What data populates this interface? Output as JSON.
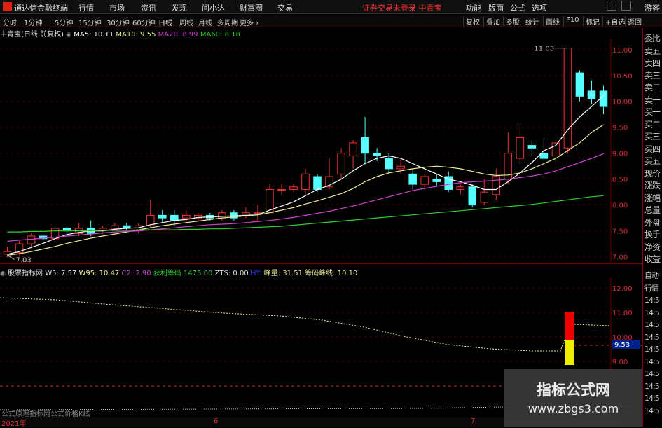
{
  "app": {
    "title": "通达信金融终端",
    "notice": "证券交易未登录",
    "stock_tab": "中青宝"
  },
  "menus": [
    "行情",
    "市场",
    "资讯",
    "发现",
    "问小达",
    "财富圈",
    "交易"
  ],
  "right_menus": [
    "功能",
    "版面",
    "公式",
    "选项"
  ],
  "guest": "游客",
  "periods": [
    "分时",
    "1分钟",
    "5分钟",
    "15分钟",
    "30分钟",
    "60分钟",
    "日线",
    "周线",
    "月线",
    "多周期",
    "更多"
  ],
  "toolbar": [
    "复权",
    "叠加",
    "多股",
    "统计",
    "画线",
    "F10",
    "标记",
    "+自选",
    "返回"
  ],
  "main_info": {
    "title": "中青宝(日线 前复权)",
    "ma5": "MA5: 10.11",
    "ma10": "MA10: 9.55",
    "ma20": "MA20: 8.99",
    "ma60": "MA60: 8.18"
  },
  "ind_info": {
    "title": "股票指标网",
    "w5": "W5: 7.57",
    "w95": "W95: 10.47",
    "c2": "C2: 2.90",
    "profit": "获利筹码",
    "profit_val": "1475.00",
    "zts": "ZTS: 0.00",
    "hy": "HY:",
    "jl": "峰量: 31.51",
    "cm": "筹码峰线: 10.10"
  },
  "price_axis": [
    "11.00",
    "10.50",
    "10.00",
    "9.50",
    "9.00",
    "8.50",
    "8.00",
    "7.50",
    "7.00"
  ],
  "ind_axis": [
    "12.00",
    "11.00",
    "10.00",
    "9.00"
  ],
  "ind_marker": "9.53",
  "high_label": "11.03",
  "low_label": "7.03",
  "right_panel": [
    "委比",
    "卖五",
    "卖四",
    "卖三",
    "卖二",
    "卖一",
    "买一",
    "买二",
    "买三",
    "买四",
    "买五",
    "现价",
    "涨跌",
    "涨幅",
    "总量",
    "外盘",
    "换手",
    "净资",
    "收益"
  ],
  "right_panel_lower": [
    "自动",
    "行情",
    "14:5",
    "14:5",
    "14:5",
    "14:5",
    "14:5",
    "14:5",
    "14:5",
    "14:5",
    "14:5",
    "14:5"
  ],
  "x_labels": [
    "2021年",
    "6",
    "7"
  ],
  "bottom_formula": "公式原理指标网公式价格K线",
  "watermark": {
    "line1": "指标公式网",
    "line2": "www.zbgs3.com"
  },
  "colors": {
    "up": "#e33",
    "down": "#5ff",
    "ma5": "#fff",
    "ma10": "#ee9",
    "ma20": "#c4c",
    "ma60": "#3c3"
  },
  "chart_data": {
    "type": "candlestick",
    "ylim": [
      6.9,
      11.2
    ],
    "candles": [
      [
        7.05,
        7.1,
        7.0,
        7.2
      ],
      [
        7.08,
        7.25,
        7.03,
        7.3
      ],
      [
        7.25,
        7.4,
        7.2,
        7.45
      ],
      [
        7.4,
        7.35,
        7.25,
        7.5
      ],
      [
        7.35,
        7.55,
        7.3,
        7.6
      ],
      [
        7.55,
        7.5,
        7.4,
        7.6
      ],
      [
        7.45,
        7.55,
        7.4,
        7.65
      ],
      [
        7.55,
        7.45,
        7.4,
        7.7
      ],
      [
        7.5,
        7.55,
        7.45,
        7.6
      ],
      [
        7.55,
        7.6,
        7.5,
        7.65
      ],
      [
        7.6,
        7.55,
        7.5,
        7.65
      ],
      [
        7.5,
        7.6,
        7.45,
        7.65
      ],
      [
        7.6,
        7.8,
        7.55,
        8.1
      ],
      [
        7.8,
        7.75,
        7.65,
        7.9
      ],
      [
        7.8,
        7.7,
        7.6,
        7.9
      ],
      [
        7.75,
        7.8,
        7.65,
        7.9
      ],
      [
        7.75,
        7.8,
        7.7,
        7.85
      ],
      [
        7.8,
        7.75,
        7.7,
        7.85
      ],
      [
        7.75,
        7.85,
        7.7,
        7.9
      ],
      [
        7.85,
        7.75,
        7.7,
        7.9
      ],
      [
        7.8,
        7.85,
        7.75,
        7.95
      ],
      [
        7.85,
        7.85,
        7.7,
        8.0
      ],
      [
        7.85,
        8.3,
        7.85,
        8.4
      ],
      [
        8.3,
        8.3,
        8.2,
        8.4
      ],
      [
        8.3,
        8.35,
        8.25,
        8.4
      ],
      [
        8.3,
        8.6,
        8.2,
        8.7
      ],
      [
        8.55,
        8.3,
        8.25,
        8.6
      ],
      [
        8.35,
        8.55,
        8.3,
        8.9
      ],
      [
        8.6,
        9.0,
        8.5,
        9.1
      ],
      [
        8.95,
        9.2,
        8.7,
        9.25
      ],
      [
        9.3,
        9.0,
        8.8,
        9.7
      ],
      [
        9.0,
        8.95,
        8.85,
        9.1
      ],
      [
        8.9,
        8.7,
        8.6,
        9.0
      ],
      [
        8.7,
        8.75,
        8.6,
        8.9
      ],
      [
        8.6,
        8.4,
        8.3,
        8.7
      ],
      [
        8.4,
        8.55,
        8.3,
        8.6
      ],
      [
        8.5,
        8.45,
        8.35,
        8.6
      ],
      [
        8.55,
        8.3,
        8.25,
        8.65
      ],
      [
        8.3,
        8.35,
        8.2,
        8.4
      ],
      [
        8.35,
        8.0,
        7.95,
        8.4
      ],
      [
        8.05,
        8.25,
        8.0,
        8.5
      ],
      [
        8.2,
        8.55,
        8.1,
        8.7
      ],
      [
        8.5,
        9.0,
        8.4,
        9.4
      ],
      [
        8.9,
        9.3,
        8.8,
        9.55
      ],
      [
        9.15,
        9.1,
        8.95,
        9.25
      ],
      [
        9.0,
        8.9,
        8.85,
        9.3
      ],
      [
        8.95,
        9.2,
        8.8,
        9.3
      ],
      [
        9.1,
        11.03,
        9.0,
        11.03
      ],
      [
        10.55,
        10.1,
        10.0,
        10.6
      ],
      [
        10.2,
        10.05,
        9.95,
        10.4
      ],
      [
        10.2,
        9.9,
        9.75,
        10.3
      ]
    ],
    "ma5": [
      7.05,
      7.1,
      7.18,
      7.26,
      7.35,
      7.43,
      7.47,
      7.5,
      7.5,
      7.53,
      7.55,
      7.56,
      7.62,
      7.66,
      7.7,
      7.72,
      7.76,
      7.77,
      7.78,
      7.79,
      7.8,
      7.81,
      7.9,
      7.98,
      8.06,
      8.18,
      8.3,
      8.38,
      8.5,
      8.66,
      8.8,
      8.9,
      8.95,
      8.9,
      8.8,
      8.7,
      8.6,
      8.5,
      8.45,
      8.38,
      8.3,
      8.3,
      8.45,
      8.62,
      8.82,
      9.05,
      9.15,
      9.45,
      9.7,
      9.9,
      10.11
    ],
    "ma10": [
      7.03,
      7.06,
      7.1,
      7.15,
      7.2,
      7.26,
      7.31,
      7.36,
      7.4,
      7.44,
      7.48,
      7.52,
      7.56,
      7.6,
      7.63,
      7.66,
      7.69,
      7.72,
      7.75,
      7.77,
      7.79,
      7.81,
      7.85,
      7.9,
      7.95,
      8.02,
      8.08,
      8.15,
      8.22,
      8.32,
      8.45,
      8.55,
      8.62,
      8.66,
      8.7,
      8.73,
      8.75,
      8.73,
      8.7,
      8.65,
      8.6,
      8.57,
      8.58,
      8.62,
      8.7,
      8.8,
      8.9,
      9.05,
      9.2,
      9.4,
      9.55
    ],
    "ma20": [
      7.3,
      7.32,
      7.34,
      7.36,
      7.38,
      7.4,
      7.42,
      7.44,
      7.46,
      7.48,
      7.49,
      7.5,
      7.52,
      7.54,
      7.56,
      7.58,
      7.6,
      7.62,
      7.63,
      7.64,
      7.66,
      7.68,
      7.7,
      7.73,
      7.76,
      7.8,
      7.84,
      7.88,
      7.93,
      7.98,
      8.04,
      8.1,
      8.16,
      8.22,
      8.28,
      8.32,
      8.36,
      8.4,
      8.43,
      8.45,
      8.46,
      8.48,
      8.5,
      8.53,
      8.56,
      8.6,
      8.66,
      8.74,
      8.82,
      8.9,
      8.99
    ],
    "ma60": [
      7.48,
      7.48,
      7.49,
      7.49,
      7.5,
      7.5,
      7.5,
      7.5,
      7.51,
      7.51,
      7.51,
      7.52,
      7.52,
      7.52,
      7.52,
      7.53,
      7.53,
      7.54,
      7.54,
      7.55,
      7.56,
      7.57,
      7.58,
      7.59,
      7.61,
      7.63,
      7.65,
      7.67,
      7.69,
      7.71,
      7.73,
      7.75,
      7.77,
      7.79,
      7.81,
      7.83,
      7.85,
      7.87,
      7.89,
      7.91,
      7.93,
      7.95,
      7.97,
      7.99,
      8.01,
      8.04,
      8.07,
      8.1,
      8.13,
      8.16,
      8.18
    ]
  }
}
